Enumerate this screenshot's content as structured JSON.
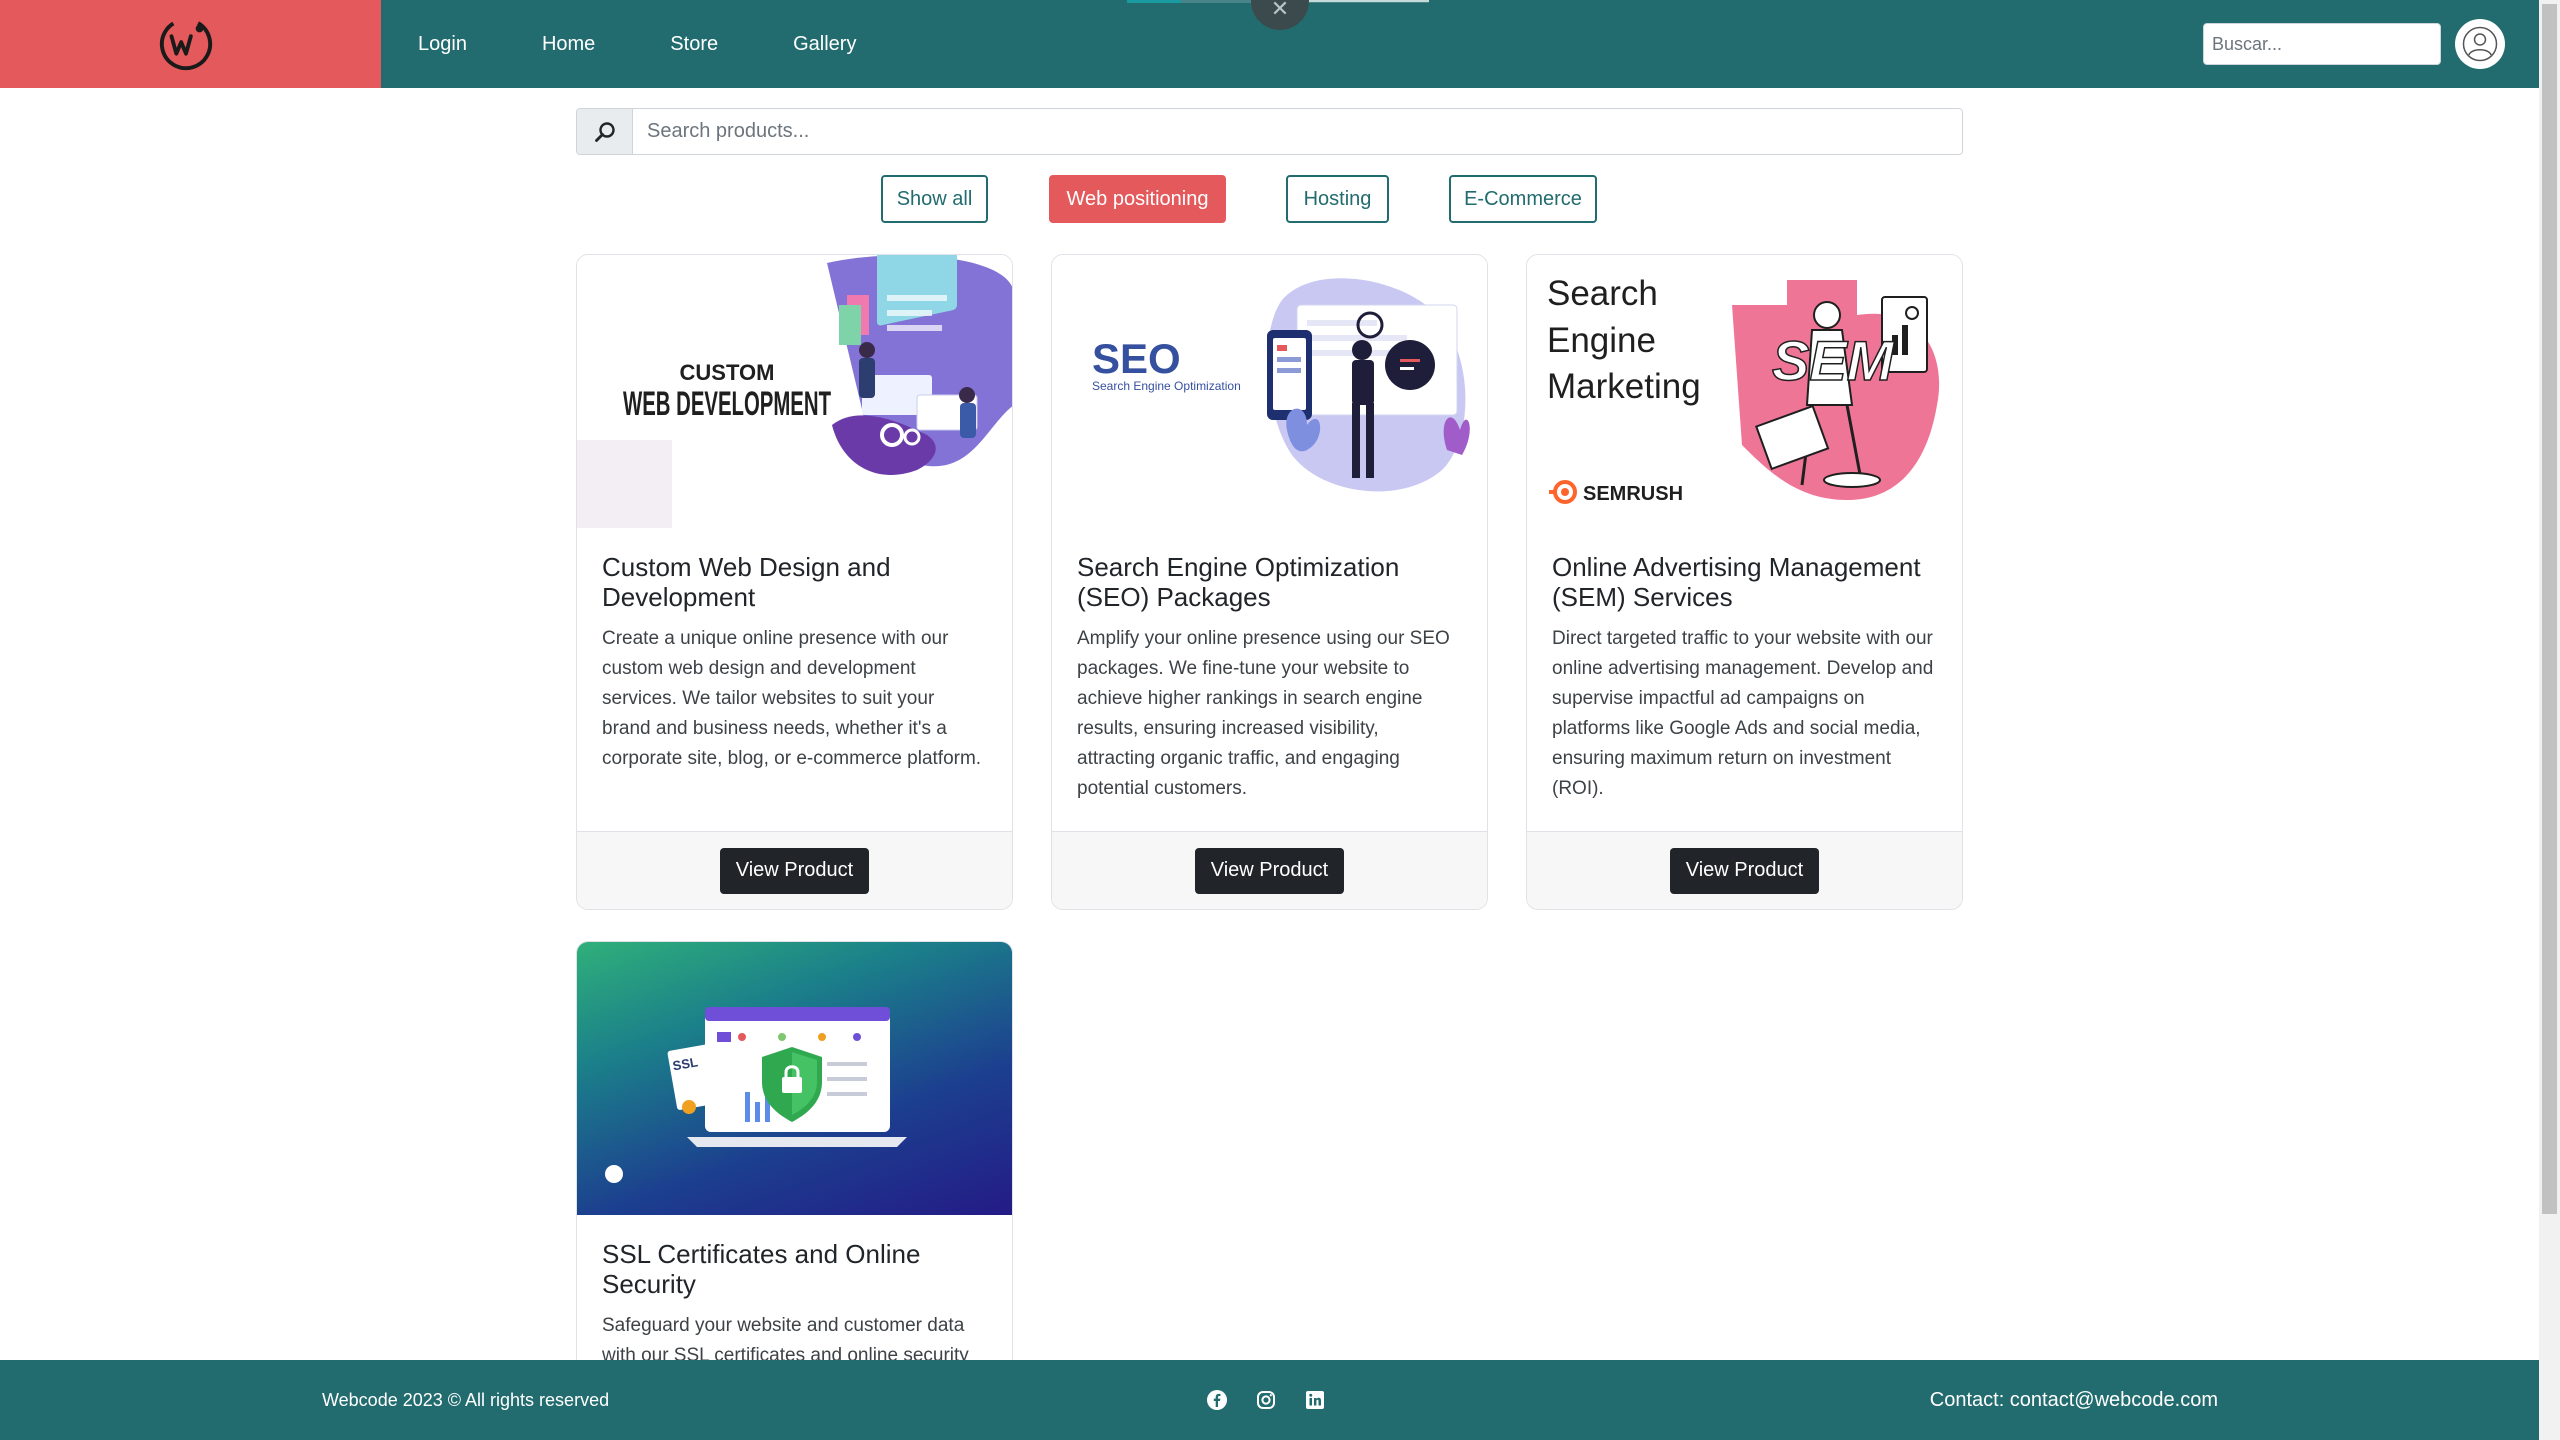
{
  "colors": {
    "primary": "#226b6e",
    "accent": "#e4595b",
    "dark": "#212529"
  },
  "nav": {
    "brand_icon": "webcode-logo-icon",
    "items": [
      {
        "label": "Login"
      },
      {
        "label": "Home"
      },
      {
        "label": "Store"
      },
      {
        "label": "Gallery"
      }
    ],
    "search_placeholder": "Buscar...",
    "avatar_icon": "user-icon",
    "close_icon": "close-icon",
    "progress": 0.18
  },
  "search": {
    "placeholder": "Search products...",
    "icon": "search-icon"
  },
  "filters": [
    {
      "label": "Show all",
      "active": false
    },
    {
      "label": "Web positioning",
      "active": true
    },
    {
      "label": "Hosting",
      "active": false
    },
    {
      "label": "E-Commerce",
      "active": false
    }
  ],
  "products": [
    {
      "image_text": [
        "CUSTOM",
        "WEB DEVELOPMENT"
      ],
      "title": "Custom Web Design and Development",
      "description": "Create a unique online presence with our custom web design and development services. We tailor websites to suit your brand and business needs, whether it's a corporate site, blog, or e-commerce platform.",
      "button": "View Product"
    },
    {
      "image_text": [
        "SEO",
        "Search Engine Optimization"
      ],
      "title": "Search Engine Optimization (SEO) Packages",
      "description": "Amplify your online presence using our SEO packages. We fine-tune your website to achieve higher rankings in search engine results, ensuring increased visibility, attracting organic traffic, and engaging potential customers.",
      "button": "View Product"
    },
    {
      "image_text": [
        "Search",
        "Engine",
        "Marketing",
        "SEM",
        "SEMRUSH"
      ],
      "title": "Online Advertising Management (SEM) Services",
      "description": "Direct targeted traffic to your website with our online advertising management. Develop and supervise impactful ad campaigns on platforms like Google Ads and social media, ensuring maximum return on investment (ROI).",
      "button": "View Product"
    },
    {
      "image_text": [
        "SSL"
      ],
      "title": "SSL Certificates and Online Security",
      "description": "Safeguard your website and customer data with our SSL certificates and online security"
    }
  ],
  "footer": {
    "copyright": "Webcode 2023 © All rights reserved",
    "social_icons": [
      "facebook-icon",
      "instagram-icon",
      "linkedin-icon"
    ],
    "contact": "Contact: contact@webcode.com"
  }
}
